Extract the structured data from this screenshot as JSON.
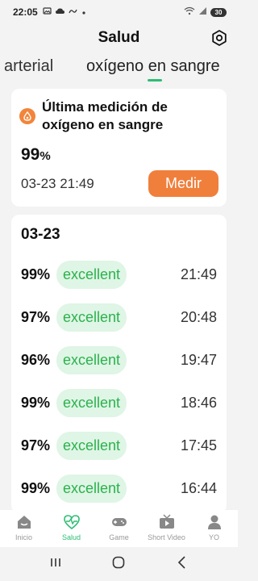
{
  "status_bar": {
    "time": "22:05",
    "battery": "30"
  },
  "header": {
    "title": "Salud",
    "settings_icon": "gear-icon"
  },
  "tabs": [
    {
      "label": "arterial",
      "active": false
    },
    {
      "label": "oxígeno en sangre",
      "active": true
    }
  ],
  "latest": {
    "title": "Última medición de oxígeno en sangre",
    "value": "99",
    "unit": "%",
    "datetime": "03-23 21:49",
    "measure_label": "Medir"
  },
  "history": {
    "date": "03-23",
    "rows": [
      {
        "value": "99%",
        "status": "excellent",
        "time": "21:49"
      },
      {
        "value": "97%",
        "status": "excellent",
        "time": "20:48"
      },
      {
        "value": "96%",
        "status": "excellent",
        "time": "19:47"
      },
      {
        "value": "99%",
        "status": "excellent",
        "time": "18:46"
      },
      {
        "value": "97%",
        "status": "excellent",
        "time": "17:45"
      },
      {
        "value": "99%",
        "status": "excellent",
        "time": "16:44"
      }
    ]
  },
  "bottom_nav": [
    {
      "label": "Inicio",
      "icon": "home-icon",
      "active": false
    },
    {
      "label": "Salud",
      "icon": "heart-pulse-icon",
      "active": true
    },
    {
      "label": "Game",
      "icon": "gamepad-icon",
      "active": false
    },
    {
      "label": "Short Video",
      "icon": "tv-icon",
      "active": false
    },
    {
      "label": "YO",
      "icon": "person-icon",
      "active": false
    }
  ],
  "colors": {
    "accent_green": "#2dbd74",
    "measure_orange": "#f07f3c",
    "badge_bg": "#dff5e6",
    "badge_text": "#2bb24c"
  }
}
